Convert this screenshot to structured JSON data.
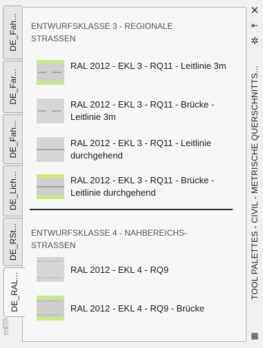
{
  "tabs": [
    {
      "label": "DE_Fah..."
    },
    {
      "label": "DE_Far..."
    },
    {
      "label": "DE_Fah..."
    },
    {
      "label": "DE_Lich..."
    },
    {
      "label": "DE_RSt..."
    },
    {
      "label": "DE_RAL..."
    }
  ],
  "palette": {
    "section1_header": "ENTWURFSKLASSE 3 - REGIONALE STRASSEN",
    "section1_items": [
      {
        "label": "RAL 2012 - EKL 3 - RQ11 - Leitlinie 3m"
      },
      {
        "label": "RAL 2012 - EKL 3 - RQ11 - Brücke - Leitlinie 3m"
      },
      {
        "label": "RAL 2012 - EKL 3 - RQ11 - Leitlinie durchgehend"
      },
      {
        "label": "RAL 2012 - EKL 3 - RQ11 - Brücke - Leitlinie durchgehend"
      }
    ],
    "section2_header": "ENTWURFSKLASSE 4 - NAHBEREICHS-STRASSEN",
    "section2_items": [
      {
        "label": "RAL 2012 - EKL 4 - RQ9"
      },
      {
        "label": "RAL 2012 - EKL 4 - RQ9 - Brücke"
      }
    ]
  },
  "titlebar": {
    "title": "TOOL PALETTES - CIVIL - METRISCHE QUERSCHNITTS...",
    "close_icon": "close-icon",
    "autohide_icon": "autohide-icon",
    "properties_icon": "properties-icon",
    "menu_icon": "menu-icon"
  },
  "colors": {
    "road_green": "#c9ea7c",
    "road_gray": "#cfcfcf",
    "lane_line": "#8a8a8a"
  }
}
